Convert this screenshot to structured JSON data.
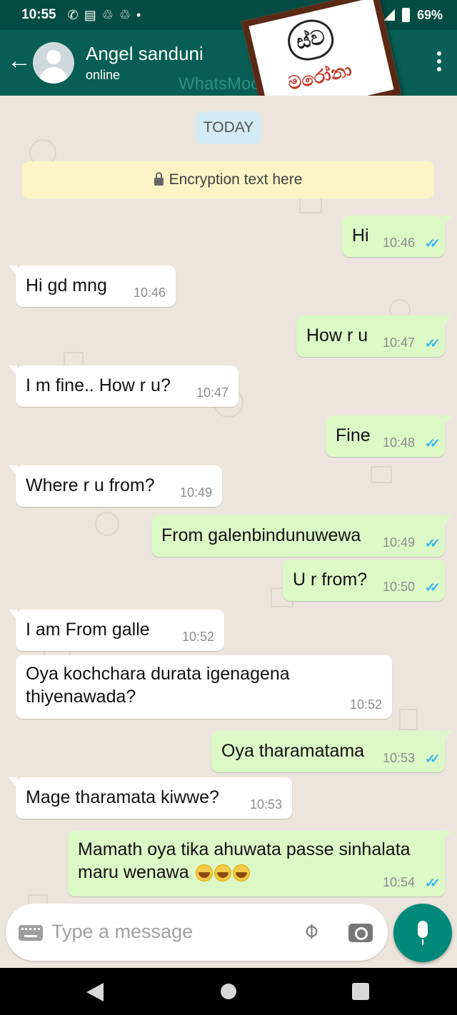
{
  "status_bar": {
    "time": "10:55",
    "battery": "69%"
  },
  "header": {
    "contact_name": "Angel sanduni",
    "status": "online",
    "watermark": "WhatsMoc",
    "sticker_face_text": "ස්ව",
    "sticker_text": "මරෝනා"
  },
  "chat": {
    "date_label": "TODAY",
    "encryption_banner": "Encryption text here",
    "messages": [
      {
        "dir": "out",
        "text": "Hi",
        "time": "10:46",
        "ticks": "✓✓"
      },
      {
        "dir": "in",
        "text": "Hi gd mng",
        "time": "10:46"
      },
      {
        "dir": "out",
        "text": "How r u",
        "time": "10:47",
        "ticks": "✓✓"
      },
      {
        "dir": "in",
        "text": "I m fine.. How r u?",
        "time": "10:47"
      },
      {
        "dir": "out",
        "text": "Fine",
        "time": "10:48",
        "ticks": "✓✓"
      },
      {
        "dir": "in",
        "text": "Where r u from?",
        "time": "10:49"
      },
      {
        "dir": "out",
        "text": "From galenbindunuwewa",
        "time": "10:49",
        "ticks": "✓✓"
      },
      {
        "dir": "out",
        "text": "U r from?",
        "time": "10:50",
        "ticks": "✓✓"
      },
      {
        "dir": "in",
        "text": "I am  From galle",
        "time": "10:52"
      },
      {
        "dir": "in",
        "text": "Oya kochchara durata igenagena thiyenawada?",
        "time": "10:52"
      },
      {
        "dir": "out",
        "text": "Oya tharamatama",
        "time": "10:53",
        "ticks": "✓✓"
      },
      {
        "dir": "in",
        "text": "Mage tharamata kiwwe?",
        "time": "10:53"
      },
      {
        "dir": "out",
        "text": "Mamath oya tika ahuwata passe sinhalata maru wenawa",
        "time": "10:54",
        "ticks": "✓✓",
        "emoji": "tears-of-joy-emoji x3"
      }
    ]
  },
  "composer": {
    "placeholder": "Type a message"
  },
  "icons": {
    "back": "arrow-left-icon",
    "menu": "more-vert-icon",
    "attach": "paperclip-icon",
    "camera": "camera-icon",
    "mic": "mic-icon"
  },
  "colors": {
    "header": "#075e54",
    "statusbar": "#054d44",
    "outgoing_bubble": "#dcf8c6",
    "incoming_bubble": "#ffffff",
    "accent": "#00897b",
    "read_ticks": "#34b7f1"
  }
}
